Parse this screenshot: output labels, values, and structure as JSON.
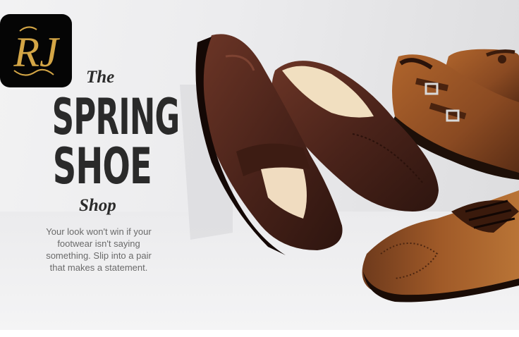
{
  "logo": {
    "monogram": "RJ"
  },
  "headline": {
    "the": "The",
    "line1": "SPRING",
    "line2": "SHOE",
    "shop": "Shop"
  },
  "description": {
    "lines": [
      "Your look won't win if your",
      "footwear isn't saying",
      "something. Slip into a pair",
      "that makes a statement."
    ]
  },
  "colors": {
    "headline": "#2a2a2a",
    "body_text": "#6a6a6a",
    "logo_bg": "#050505",
    "logo_gold": "#d4a646",
    "dark_leather": "#4a231a",
    "tan_leather": "#8a4a22"
  }
}
